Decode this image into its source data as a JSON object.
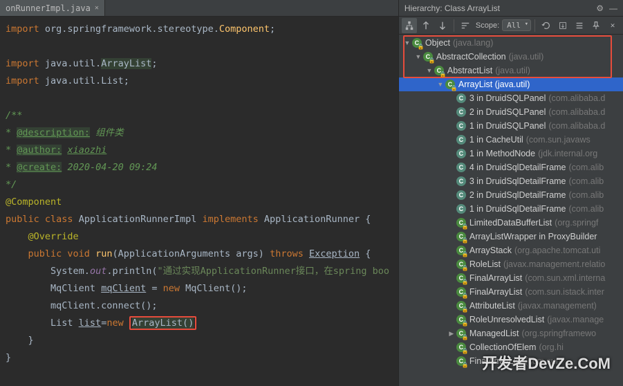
{
  "tab": {
    "name": "onRunnerImpl.java"
  },
  "code": {
    "l1a": "import",
    "l1b": " org.springframework.stereotype.",
    "l1c": "Component",
    "l1d": ";",
    "l3a": "import",
    "l3b": " java.util.",
    "l3c": "ArrayList",
    "l3d": ";",
    "l4a": "import",
    "l4b": " java.util.",
    "l4c": "List",
    "l4d": ";",
    "doc_open": "/**",
    "doc_desc_tag": "@description:",
    "doc_desc_txt": " 组件类",
    "doc_auth_tag": "@author:",
    "doc_auth_val": "xiaozhi",
    "doc_create_tag": "@create:",
    "doc_create_val": "2020-04-20 09:24",
    "doc_close": " */",
    "star": " * ",
    "ann_comp": "@Component",
    "pub": "public ",
    "cls": "class ",
    "appimpl": "ApplicationRunnerImpl ",
    "impl": "implements ",
    "apprun": "ApplicationRunner ",
    "ob": "{",
    "ann_over": "@Override",
    "void": "void ",
    "run": "run",
    "argtype": "ApplicationArguments ",
    "argname": "args",
    "throws": " throws ",
    "exc": "Exception",
    "sysout_a": "System.",
    "sysout_b": "out",
    "sysout_c": ".println(",
    "sysout_d": "\"通过实现ApplicationRunner接口，在spring boo",
    "sysout_e": "",
    "mq1a": "MqClient ",
    "mq1b": "mqClient",
    "mq1c": " = ",
    "mq1d": "new ",
    "mq1e": "MqClient();",
    "mq2": "mqClient.connect();",
    "list_a": "List ",
    "list_b": "list",
    "list_c": "=",
    "list_d": "new ",
    "list_e": "ArrayList()",
    "cb": "}"
  },
  "hierarchy": {
    "title": "Hierarchy:  Class ArrayList",
    "scope_label": "Scope:",
    "scope_value": "All",
    "nodes": {
      "obj_name": "Object",
      "obj_pkg": "(java.lang)",
      "abscol_name": "AbstractCollection",
      "abscol_pkg": "(java.util)",
      "abslist_name": "AbstractList",
      "abslist_pkg": "(java.util)",
      "arrlist_name": "ArrayList (java.util)",
      "u1": "3 in DruidSQLPanel",
      "u1p": "(com.alibaba.d",
      "u2": "2 in DruidSQLPanel",
      "u2p": "(com.alibaba.d",
      "u3": "1 in DruidSQLPanel",
      "u3p": "(com.alibaba.d",
      "u4": "1 in CacheUtil",
      "u4p": "(com.sun.javaws",
      "u5": "1 in MethodNode",
      "u5p": "(jdk.internal.org",
      "u6": "4 in DruidSqlDetailFrame",
      "u6p": "(com.alib",
      "u7": "3 in DruidSqlDetailFrame",
      "u7p": "(com.alib",
      "u8": "2 in DruidSqlDetailFrame",
      "u8p": "(com.alib",
      "u9": "1 in DruidSqlDetailFrame",
      "u9p": "(com.alib",
      "u10": "LimitedDataBufferList",
      "u10p": "(org.springf",
      "u11": "ArrayListWrapper in ProxyBuilder",
      "u12": "ArrayStack",
      "u12p": "(org.apache.tomcat.uti",
      "u13": "RoleList",
      "u13p": "(javax.management.relatio",
      "u14": "FinalArrayList",
      "u14p": "(com.sun.xml.interna",
      "u15": "FinalArrayList",
      "u15p": "(com.sun.istack.inter",
      "u16": "AttributeList",
      "u16p": "(javax.management)",
      "u17": "RoleUnresolvedList",
      "u17p": "(javax.manage",
      "u18": "ManagedList",
      "u18p": "(org.springframewo",
      "u19": "CollectionOfElem",
      "u19p": "(org.hi",
      "u20": "FinalArrayList",
      "u20p": "(com.sun"
    }
  },
  "watermark": "开发者DevZe.CoM"
}
